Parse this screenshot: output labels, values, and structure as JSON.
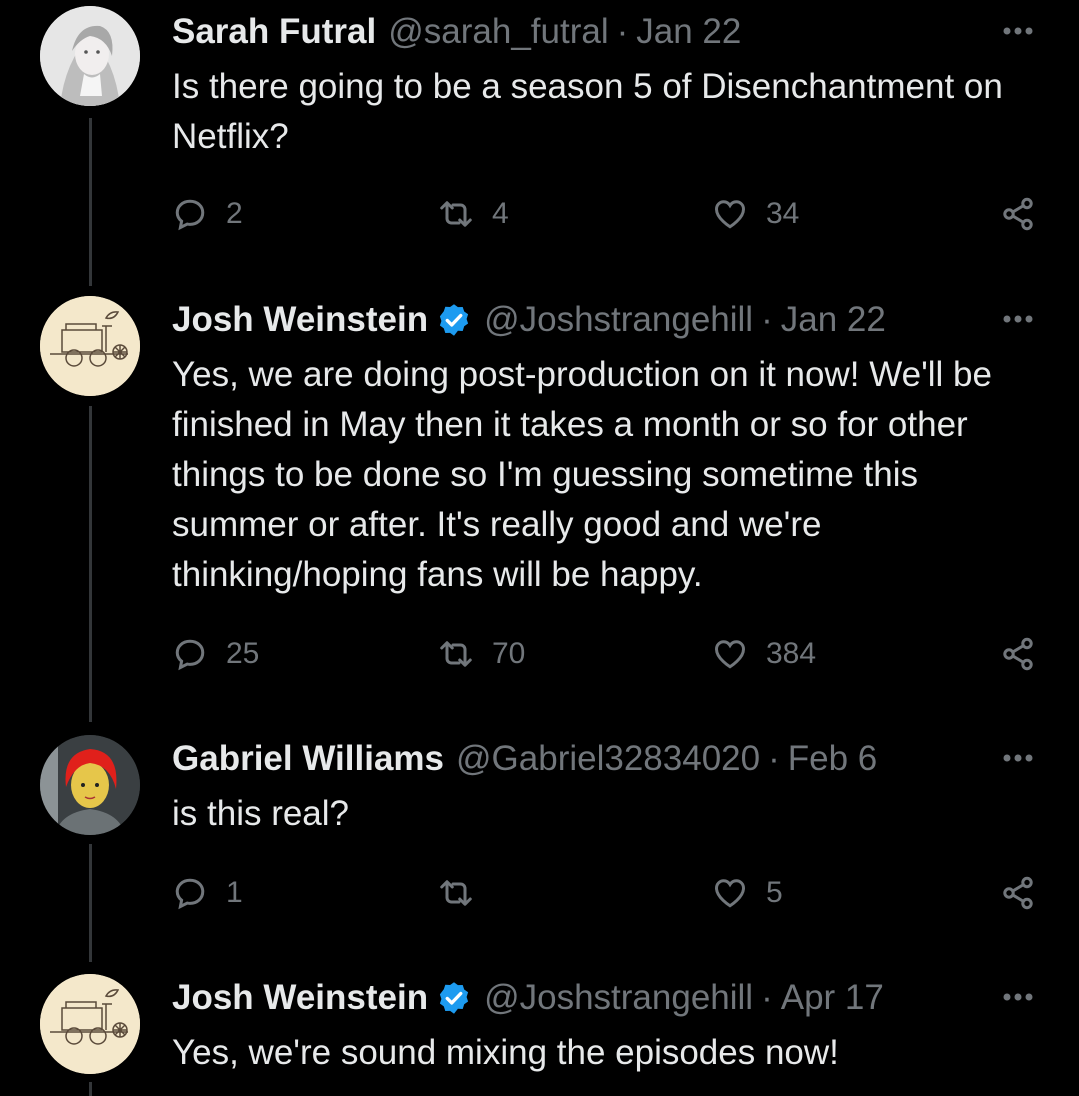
{
  "tweets": [
    {
      "name": "Sarah Futral",
      "verified": false,
      "handle": "@sarah_futral",
      "date": "Jan 22",
      "text": "Is there going to be a season 5 of Disenchantment on Netflix?",
      "replies": "2",
      "retweets": "4",
      "likes": "34"
    },
    {
      "name": "Josh Weinstein",
      "verified": true,
      "handle": "@Joshstrangehill",
      "date": "Jan 22",
      "text": "Yes, we are doing post-production on it now! We'll be finished in May then it takes a month or so for other things to be done so I'm guessing sometime this summer or after. It's really good and we're thinking/hoping fans will be happy.",
      "replies": "25",
      "retweets": "70",
      "likes": "384"
    },
    {
      "name": "Gabriel Williams",
      "verified": false,
      "handle": "@Gabriel32834020",
      "date": "Feb 6",
      "text": "is this real?",
      "replies": "1",
      "retweets": "",
      "likes": "5"
    },
    {
      "name": "Josh Weinstein",
      "verified": true,
      "handle": "@Joshstrangehill",
      "date": "Apr 17",
      "text": "Yes, we're sound mixing the episodes now!"
    }
  ],
  "separator": "·",
  "colors": {
    "background": "#000000",
    "text": "#e7e9ea",
    "muted": "#71767b",
    "verified": "#1d9bf0",
    "thread": "#333639"
  },
  "icons": {
    "reply": "reply-icon",
    "retweet": "retweet-icon",
    "like": "heart-icon",
    "share": "share-icon",
    "more": "more-icon",
    "verified": "verified-badge-icon"
  }
}
